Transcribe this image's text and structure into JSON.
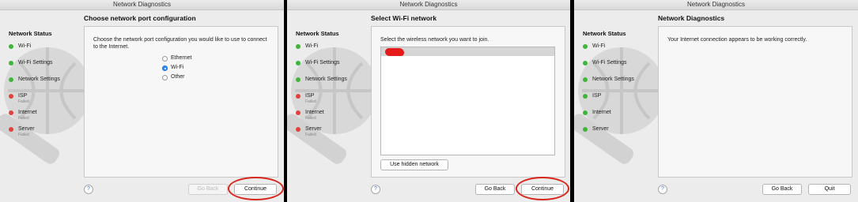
{
  "window_title": "Network Diagnostics",
  "status_title": "Network Status",
  "help_label": "?",
  "screen1": {
    "heading": "Choose network port configuration",
    "prompt": "Choose the network port configuration you would like to use to connect to the Internet.",
    "options": [
      {
        "label": "Ethernet",
        "selected": false
      },
      {
        "label": "Wi-Fi",
        "selected": true
      },
      {
        "label": "Other",
        "selected": false
      }
    ],
    "back": "Go Back",
    "continue": "Continue",
    "steps": [
      {
        "label": "Wi-Fi",
        "state": "ok",
        "sub": ""
      },
      {
        "label": "Wi-Fi Settings",
        "state": "ok",
        "sub": ""
      },
      {
        "label": "Network Settings",
        "state": "ok",
        "sub": ""
      },
      {
        "label": "ISP",
        "state": "fail",
        "sub": "Failed"
      },
      {
        "label": "Internet",
        "state": "fail",
        "sub": "Failed"
      },
      {
        "label": "Server",
        "state": "fail",
        "sub": "Failed"
      }
    ]
  },
  "screen2": {
    "heading": "Select Wi-Fi network",
    "prompt": "Select the wireless network you want to join.",
    "hidden": "Use hidden network",
    "back": "Go Back",
    "continue": "Continue",
    "steps": [
      {
        "label": "Wi-Fi",
        "state": "ok",
        "sub": ""
      },
      {
        "label": "Wi-Fi Settings",
        "state": "ok",
        "sub": ""
      },
      {
        "label": "Network Settings",
        "state": "ok",
        "sub": ""
      },
      {
        "label": "ISP",
        "state": "fail",
        "sub": "Failed"
      },
      {
        "label": "Internet",
        "state": "fail",
        "sub": "Failed"
      },
      {
        "label": "Server",
        "state": "fail",
        "sub": "Failed"
      }
    ]
  },
  "screen3": {
    "heading": "Network Diagnostics",
    "message": "Your Internet connection appears to be working correctly.",
    "back": "Go Back",
    "quit": "Quit",
    "steps": [
      {
        "label": "Wi-Fi",
        "state": "ok",
        "sub": ""
      },
      {
        "label": "Wi-Fi Settings",
        "state": "ok",
        "sub": ""
      },
      {
        "label": "Network Settings",
        "state": "ok",
        "sub": ""
      },
      {
        "label": "ISP",
        "state": "ok",
        "sub": ""
      },
      {
        "label": "Internet",
        "state": "ok",
        "sub": ""
      },
      {
        "label": "Server",
        "state": "ok",
        "sub": ""
      }
    ]
  },
  "colors": {
    "ok": "#3fb53c",
    "fail": "#e0423d",
    "annotation": "#d9261c",
    "selected_radio": "#2a8df5"
  }
}
